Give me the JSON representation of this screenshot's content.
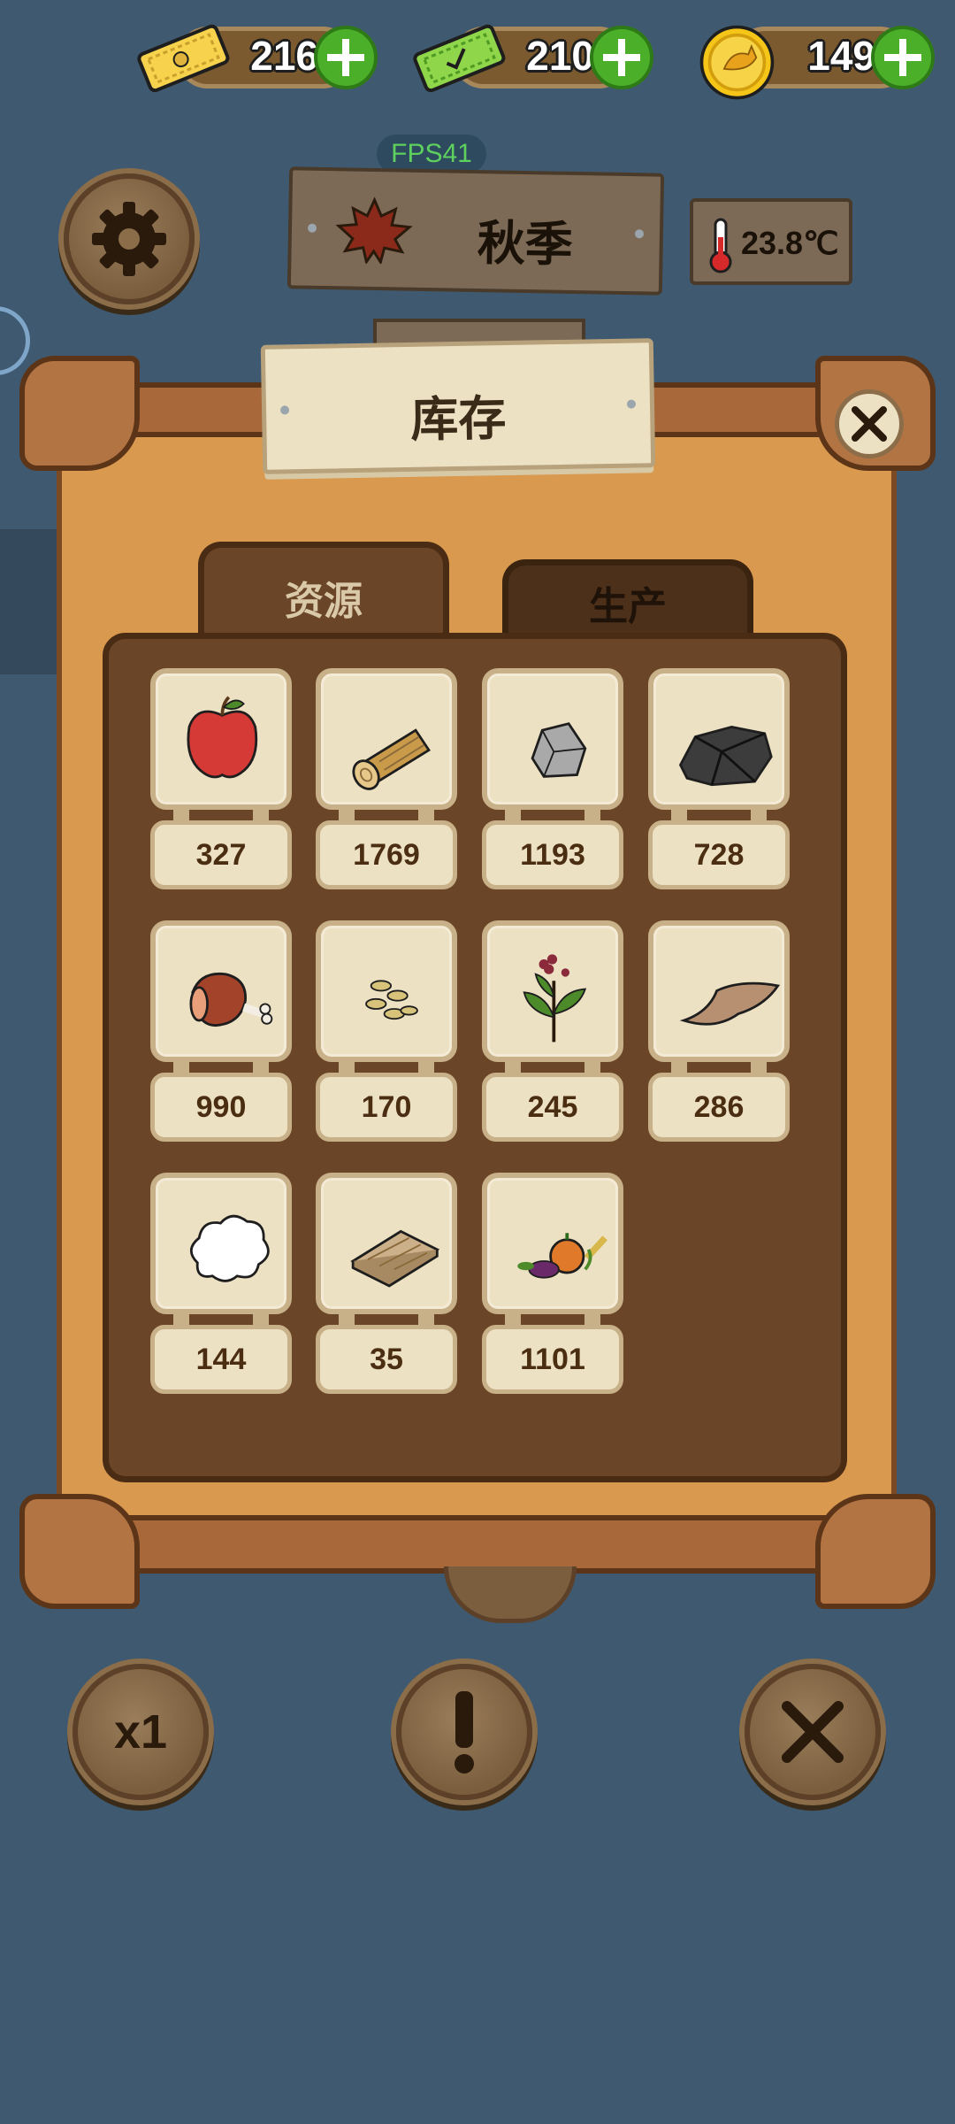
{
  "currencies": [
    {
      "name": "tickets",
      "value": "216"
    },
    {
      "name": "green-tickets",
      "value": "210"
    },
    {
      "name": "coins",
      "value": "149"
    }
  ],
  "fps": "FPS41",
  "season": {
    "label": "秋季"
  },
  "temperature": "23.8℃",
  "dialog": {
    "title": "库存",
    "tabs": [
      {
        "label": "资源",
        "active": true
      },
      {
        "label": "生产",
        "active": false
      }
    ]
  },
  "resources": [
    {
      "icon": "apple-icon",
      "count": "327"
    },
    {
      "icon": "log-icon",
      "count": "1769"
    },
    {
      "icon": "stone-icon",
      "count": "1193"
    },
    {
      "icon": "coal-icon",
      "count": "728"
    },
    {
      "icon": "meat-icon",
      "count": "990"
    },
    {
      "icon": "seeds-icon",
      "count": "170"
    },
    {
      "icon": "herb-icon",
      "count": "245"
    },
    {
      "icon": "leather-icon",
      "count": "286"
    },
    {
      "icon": "cotton-icon",
      "count": "144"
    },
    {
      "icon": "plank-icon",
      "count": "35"
    },
    {
      "icon": "vegetables-icon",
      "count": "1101"
    }
  ],
  "bottom_bar": {
    "speed_label": "x1"
  },
  "colors": {
    "background": "#3f5a70",
    "board": "#d9994e",
    "inner_panel": "#6b4527",
    "accent_green": "#4caf2a"
  }
}
